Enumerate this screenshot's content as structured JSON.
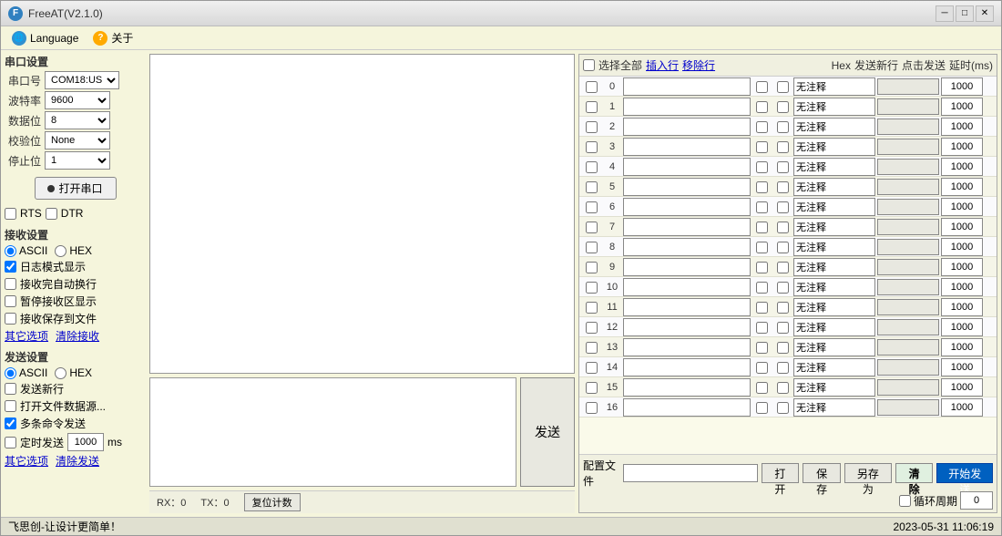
{
  "window": {
    "title": "FreeAT(V2.1.0)"
  },
  "menu": {
    "language": "Language",
    "about": "关于"
  },
  "serial_settings": {
    "section": "串口设置",
    "port_label": "串口号",
    "port_value": "COM18:US",
    "baud_label": "波特率",
    "baud_value": "9600",
    "data_label": "数据位",
    "data_value": "8",
    "parity_label": "校验位",
    "parity_value": "None",
    "stop_label": "停止位",
    "stop_value": "1",
    "open_btn": "打开串口",
    "rts_label": "RTS",
    "dtr_label": "DTR"
  },
  "receive_settings": {
    "section": "接收设置",
    "ascii": "ASCII",
    "hex": "HEX",
    "log_mode": "日志模式显示",
    "auto_wrap": "接收完自动换行",
    "pause_display": "暂停接收区显示",
    "save_file": "接收保存到文件",
    "other_options": "其它选项",
    "clear_recv": "清除接收"
  },
  "send_settings": {
    "section": "发送设置",
    "ascii": "ASCII",
    "hex": "HEX",
    "send_newline": "发送新行",
    "open_file": "打开文件数据源...",
    "multi_cmd": "多条命令发送",
    "timed_send": "定时发送",
    "timed_value": "1000",
    "timed_unit": "ms",
    "other_options": "其它选项",
    "clear_send": "清除发送"
  },
  "right_panel": {
    "select_all": "选择全部",
    "insert_row": "插入行",
    "delete_row": "移除行",
    "hex_label": "Hex",
    "send_newline": "发送新行",
    "click_send": "点击发送",
    "delay_label": "延时(ms)",
    "rows": [
      {
        "num": "0",
        "hex": false,
        "nl": false,
        "comment": "无注释",
        "delay": "1000"
      },
      {
        "num": "1",
        "hex": false,
        "nl": false,
        "comment": "无注释",
        "delay": "1000"
      },
      {
        "num": "2",
        "hex": false,
        "nl": false,
        "comment": "无注释",
        "delay": "1000"
      },
      {
        "num": "3",
        "hex": false,
        "nl": false,
        "comment": "无注释",
        "delay": "1000"
      },
      {
        "num": "4",
        "hex": false,
        "nl": false,
        "comment": "无注释",
        "delay": "1000"
      },
      {
        "num": "5",
        "hex": false,
        "nl": false,
        "comment": "无注释",
        "delay": "1000"
      },
      {
        "num": "6",
        "hex": false,
        "nl": false,
        "comment": "无注释",
        "delay": "1000"
      },
      {
        "num": "7",
        "hex": false,
        "nl": false,
        "comment": "无注释",
        "delay": "1000"
      },
      {
        "num": "8",
        "hex": false,
        "nl": false,
        "comment": "无注释",
        "delay": "1000"
      },
      {
        "num": "9",
        "hex": false,
        "nl": false,
        "comment": "无注释",
        "delay": "1000"
      },
      {
        "num": "10",
        "hex": false,
        "nl": false,
        "comment": "无注释",
        "delay": "1000"
      },
      {
        "num": "11",
        "hex": false,
        "nl": false,
        "comment": "无注释",
        "delay": "1000"
      },
      {
        "num": "12",
        "hex": false,
        "nl": false,
        "comment": "无注释",
        "delay": "1000"
      },
      {
        "num": "13",
        "hex": false,
        "nl": false,
        "comment": "无注释",
        "delay": "1000"
      },
      {
        "num": "14",
        "hex": false,
        "nl": false,
        "comment": "无注释",
        "delay": "1000"
      },
      {
        "num": "15",
        "hex": false,
        "nl": false,
        "comment": "无注释",
        "delay": "1000"
      },
      {
        "num": "16",
        "hex": false,
        "nl": false,
        "comment": "无注释",
        "delay": "1000"
      }
    ]
  },
  "footer": {
    "config_label": "配置文件",
    "config_value": "",
    "open_btn": "打开",
    "save_btn": "保存",
    "save_as_btn": "另存为",
    "clear_btn": "清除",
    "start_send_btn": "开始发送",
    "cycle_label": "循环周期",
    "cycle_value": "0"
  },
  "status_bar": {
    "rx_label": "RX：",
    "rx_value": "0",
    "tx_label": "TX：",
    "tx_value": "0",
    "reset_btn": "复位计数"
  },
  "bottom_bar": {
    "left": "飞思创-让设计更简单！",
    "right": "2023-05-31 11:06:19"
  },
  "send_btn": "发送"
}
